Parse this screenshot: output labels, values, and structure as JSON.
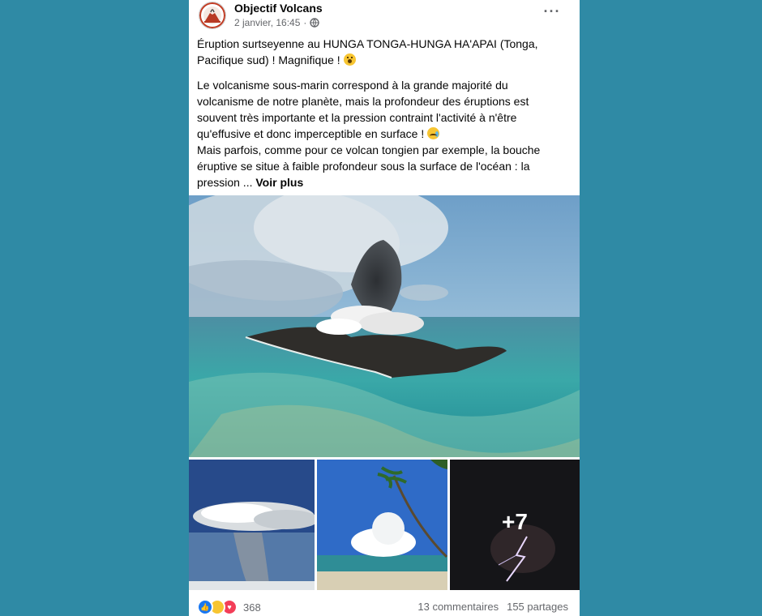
{
  "post": {
    "page_name": "Objectif Volcans",
    "date": "2 janvier, 16:45",
    "audience_icon": "globe-icon",
    "menu_icon": "more-options-icon",
    "paragraph1": "Éruption surtseyenne au HUNGA TONGA-HUNGA HA'APAI (Tonga, Pacifique sud) ! Magnifique ! ",
    "paragraph2_line1": "Le volcanisme sous-marin correspond à la grande majorité du volcanisme de notre planète, mais la profondeur des éruptions est souvent très importante et la pression contraint l'activité à n'être qu'effusive et donc imperceptible en surface ! ",
    "paragraph2_line2": "Mais parfois, comme pour ce volcan tongien par exemple, la bouche éruptive se situe à faible profondeur sous la surface de l'océan : la pression ... ",
    "see_more": "Voir plus",
    "extra_photos": "+7"
  },
  "footer": {
    "reaction_count": "368",
    "comments": "13 commentaires",
    "shares": "155 partages",
    "reactions": [
      "like-icon",
      "wow-icon",
      "love-icon"
    ]
  },
  "colors": {
    "background": "#2f8aa5",
    "card": "#ffffff",
    "secondary_text": "#65676b",
    "like": "#1877f2"
  }
}
